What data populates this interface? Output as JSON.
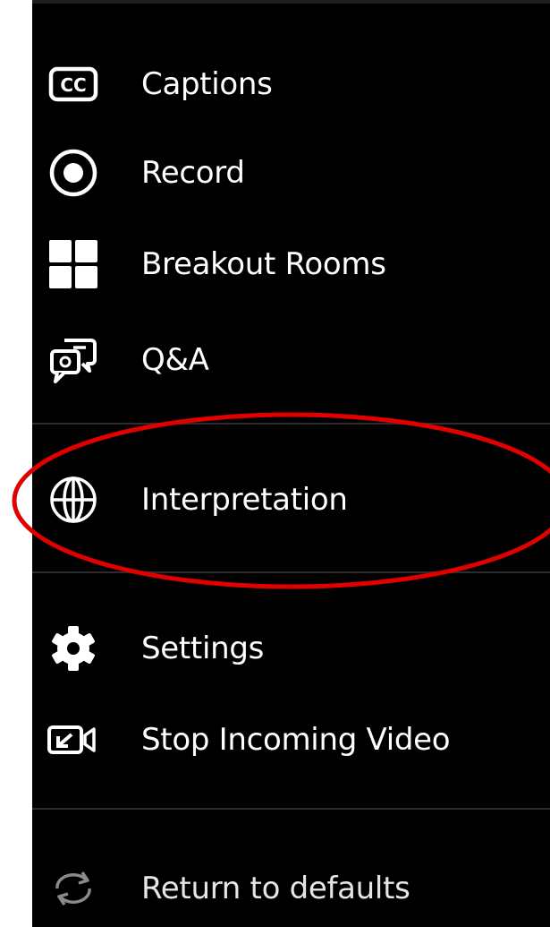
{
  "menu": {
    "items": [
      {
        "label": "Captions",
        "icon": "closed-captions-icon"
      },
      {
        "label": "Record",
        "icon": "record-icon"
      },
      {
        "label": "Breakout Rooms",
        "icon": "breakout-rooms-icon"
      },
      {
        "label": "Q&A",
        "icon": "qa-icon"
      },
      {
        "label": "Interpretation",
        "icon": "globe-icon"
      },
      {
        "label": "Settings",
        "icon": "gear-icon"
      },
      {
        "label": "Stop Incoming Video",
        "icon": "stop-video-icon"
      },
      {
        "label": "Return to defaults",
        "icon": "reset-icon"
      }
    ]
  },
  "annotation": {
    "color": "#e00000",
    "highlighted_item": "Interpretation"
  }
}
